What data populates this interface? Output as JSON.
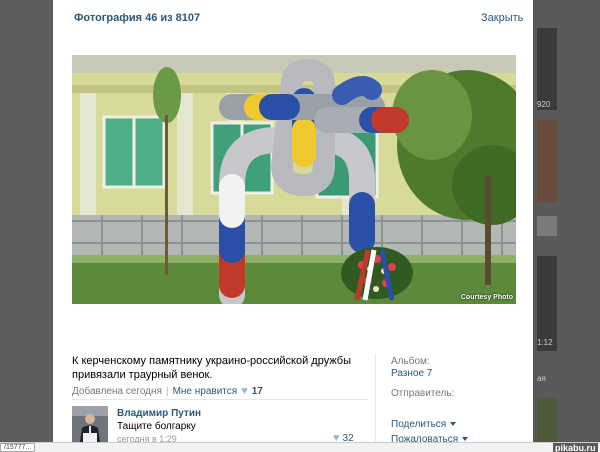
{
  "viewer": {
    "title": "Фотография 46 из 8107",
    "close": "Закрыть"
  },
  "photo": {
    "credit": "Courtesy Photo"
  },
  "post": {
    "caption": "К керченскому памятнику украино-российской дружбы привязали траурный венок.",
    "added": "Добавлена сегодня",
    "like_label": "Мне нравится",
    "likes": "17"
  },
  "comment": {
    "author": "Владимир Путин",
    "text": "Тащите болгарку",
    "date": "сегодня в 1:29",
    "likes": "32"
  },
  "sidebar": {
    "album_label": "Альбом:",
    "album_name": "Разное 7",
    "sender_label": "Отправитель:",
    "share": "Поделиться",
    "report": "Пожаловаться"
  },
  "background": {
    "text_920": "920",
    "text_112": "1:12",
    "text_ay": "ая"
  },
  "status": {
    "url": "/15777...",
    "watermark": "pikabu.ru"
  },
  "colors": {
    "link": "#2b587a",
    "overlay": "#5d5d5d"
  }
}
